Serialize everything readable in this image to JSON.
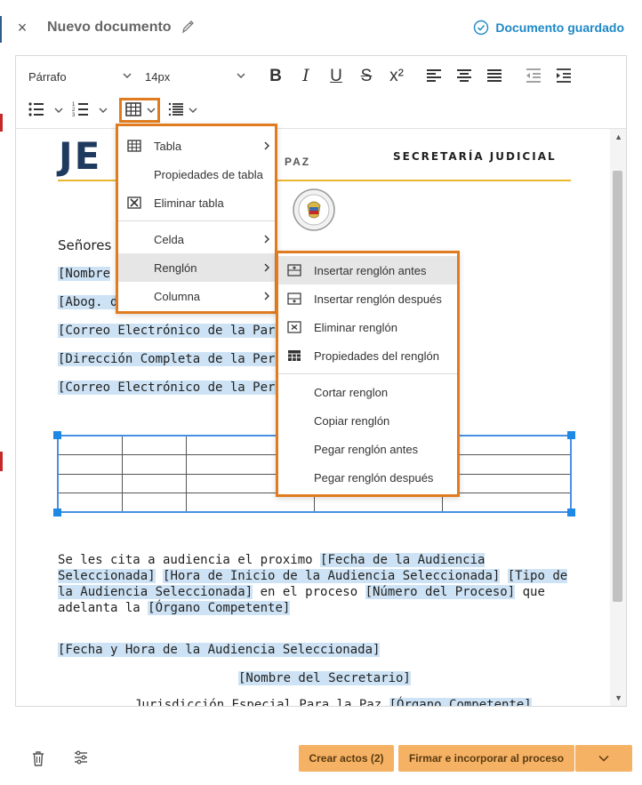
{
  "header": {
    "close_glyph": "×",
    "title": "Nuevo documento",
    "saved_text": "Documento guardado"
  },
  "toolbar": {
    "paragraph_select": "Párrafo",
    "font_size_select": "14px",
    "icons": [
      "bold-icon",
      "italic-icon",
      "underline-icon",
      "strikethrough-icon",
      "superscript-icon",
      "align-left-icon",
      "align-center-icon",
      "align-justify-icon",
      "outdent-icon",
      "indent-icon",
      "bullet-list-icon",
      "numbered-list-icon",
      "table-icon",
      "line-spacing-icon"
    ]
  },
  "document": {
    "logo_text": "JE",
    "logo_sub": "PAZ",
    "secretaria": "SECRETARÍA JUDICIAL",
    "senores": "Señores",
    "field_nombre": "[Nombre",
    "field_abog": "[Abog. de",
    "field_correo_parte": "[Correo Electrónico de la Parte Acti",
    "field_direccion": "[Dirección Completa de la Persona",
    "field_correo_persona": "[Correo Electrónico de la Persona S",
    "para_lead": "Se les cita a audiencia el proximo ",
    "para_fecha": "[Fecha de la Audiencia Seleccionada]",
    "para_hora": "[Hora de Inicio de la Audiencia Seleccionada]",
    "para_tipo": "[Tipo de la Audiencia Seleccionada]",
    "para_en_el": " en el proceso ",
    "para_numero": "[Número del Proceso]",
    "para_que": " que adelanta la ",
    "para_organo": "[Órgano Competente]",
    "fecha_hora": "[Fecha y Hora de la Audiencia Seleccionada]",
    "nombre_secretario": "[Nombre del Secretario]",
    "jurisdiccion": "Jurisdicción Especial Para la Paz",
    "jurisdiccion_field": "[Órgano Competente]"
  },
  "table_menu": {
    "items": [
      {
        "label": "Tabla",
        "icon": "table-grid-icon",
        "submenu": true
      },
      {
        "label": "Propiedades de tabla",
        "icon": "",
        "submenu": false
      },
      {
        "label": "Eliminar tabla",
        "icon": "delete-table-icon",
        "submenu": false
      },
      {
        "label": "Celda",
        "icon": "",
        "submenu": true
      },
      {
        "label": "Renglón",
        "icon": "",
        "submenu": true
      },
      {
        "label": "Columna",
        "icon": "",
        "submenu": true
      }
    ]
  },
  "row_menu": {
    "items": [
      {
        "label": "Insertar renglón antes",
        "icon": "insert-row-before-icon"
      },
      {
        "label": "Insertar renglón después",
        "icon": "insert-row-after-icon"
      },
      {
        "label": "Eliminar renglón",
        "icon": "delete-row-icon"
      },
      {
        "label": "Propiedades del renglón",
        "icon": "row-properties-icon"
      },
      {
        "label": "Cortar renglon",
        "icon": ""
      },
      {
        "label": "Copiar renglón",
        "icon": ""
      },
      {
        "label": "Pegar renglón antes",
        "icon": ""
      },
      {
        "label": "Pegar renglón después",
        "icon": ""
      }
    ]
  },
  "bottom": {
    "crear_actos": "Crear actos (2)",
    "firmar": "Firmar e incorporar al proceso"
  },
  "colors": {
    "accent_blue": "#1e88c7",
    "menu_border": "#e07b1f",
    "button_orange": "#f5b264",
    "highlight": "#cde3f5"
  }
}
